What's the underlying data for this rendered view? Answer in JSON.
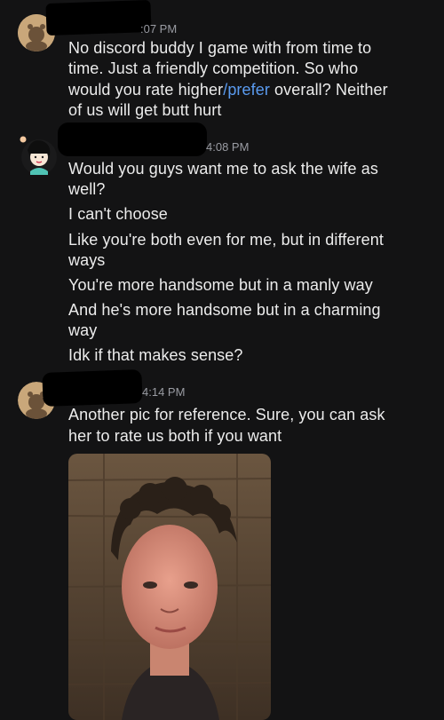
{
  "messages": [
    {
      "time": ":07 PM",
      "lines": [
        "No discord buddy I game with from time to",
        "time. Just a friendly competition. So who",
        "would you rate higher",
        "/prefer",
        " overall? Neither",
        "of us will get butt hurt"
      ]
    },
    {
      "time": "4:08 PM",
      "lines": [
        "Would you guys want me to ask the wife as",
        "well?",
        "I can't choose",
        "Like you're both even for me, but in different",
        "ways",
        "You're more handsome but in a manly way",
        "And he's more handsome but in a charming",
        "way",
        "Idk if that makes sense?"
      ]
    },
    {
      "time": "4:14 PM",
      "lines": [
        "Another pic for reference. Sure, you can ask",
        "her to rate us both if you want"
      ]
    }
  ],
  "colors": {
    "background": "#131314",
    "text": "#ececec",
    "link": "#5a9bf0",
    "timestamp": "#9a9ca3"
  }
}
